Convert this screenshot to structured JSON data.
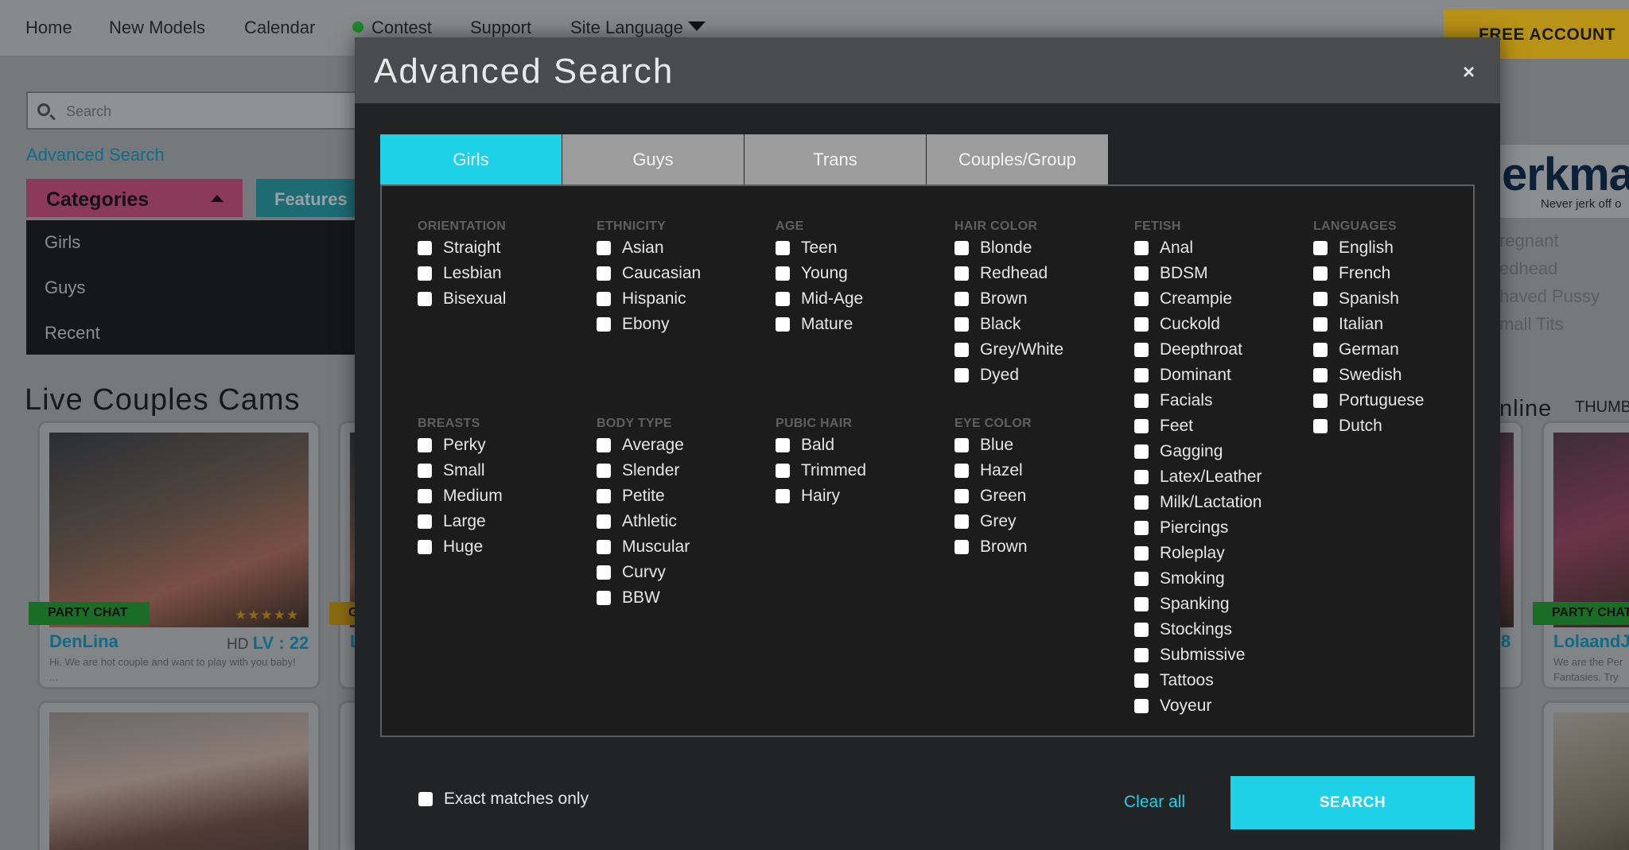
{
  "nav": {
    "home": "Home",
    "new_models": "New Models",
    "calendar": "Calendar",
    "contest": "Contest",
    "support": "Support",
    "site_language": "Site Language",
    "free_account": "FREE ACCOUNT"
  },
  "search": {
    "placeholder": "Search"
  },
  "advanced_search_link": "Advanced Search",
  "sidebar": {
    "categories_label": "Categories",
    "features_label": "Features",
    "items": [
      "Girls",
      "Guys",
      "Recent"
    ]
  },
  "live_title": "Live Couples Cams",
  "cards": [
    {
      "badge": "PARTY CHAT",
      "stars": "★★★★★",
      "name": "DenLina",
      "hd": "HD",
      "lv": "LV : 22",
      "desc": "Hi. We are hot couple and want to play with you baby! ..."
    },
    {
      "badge": "PARTY CHAT",
      "name": "LolaandJ",
      "desc": "We are the Per Fantasies. Try"
    }
  ],
  "partial_text": {
    "right_list": [
      "regnant",
      "edhead",
      "haved Pussy",
      "mall Tits"
    ],
    "online": "nline",
    "thumb": "THUMB",
    "erk_big": "erkma",
    "erk_small": "Never jerk off o",
    "num_8": "8",
    "mid_card_letter": "G",
    "mid_card_name": "L"
  },
  "modal": {
    "title": "Advanced Search",
    "close": "×",
    "tabs": [
      "Girls",
      "Guys",
      "Trans",
      "Couples/Group"
    ],
    "active_tab": "Girls",
    "groups": {
      "orientation": {
        "title": "ORIENTATION",
        "options": [
          "Straight",
          "Lesbian",
          "Bisexual"
        ]
      },
      "ethnicity": {
        "title": "ETHNICITY",
        "options": [
          "Asian",
          "Caucasian",
          "Hispanic",
          "Ebony"
        ]
      },
      "age": {
        "title": "AGE",
        "options": [
          "Teen",
          "Young",
          "Mid-Age",
          "Mature"
        ]
      },
      "hair_color": {
        "title": "HAIR COLOR",
        "options": [
          "Blonde",
          "Redhead",
          "Brown",
          "Black",
          "Grey/White",
          "Dyed"
        ]
      },
      "fetish": {
        "title": "FETISH",
        "options": [
          "Anal",
          "BDSM",
          "Creampie",
          "Cuckold",
          "Deepthroat",
          "Dominant",
          "Facials",
          "Feet",
          "Gagging",
          "Latex/Leather",
          "Milk/Lactation",
          "Piercings",
          "Roleplay",
          "Smoking",
          "Spanking",
          "Stockings",
          "Submissive",
          "Tattoos",
          "Voyeur"
        ]
      },
      "languages": {
        "title": "LANGUAGES",
        "options": [
          "English",
          "French",
          "Spanish",
          "Italian",
          "German",
          "Swedish",
          "Portuguese",
          "Dutch"
        ]
      },
      "breasts": {
        "title": "BREASTS",
        "options": [
          "Perky",
          "Small",
          "Medium",
          "Large",
          "Huge"
        ]
      },
      "body_type": {
        "title": "BODY TYPE",
        "options": [
          "Average",
          "Slender",
          "Petite",
          "Athletic",
          "Muscular",
          "Curvy",
          "BBW"
        ]
      },
      "pubic_hair": {
        "title": "PUBIC HAIR",
        "options": [
          "Bald",
          "Trimmed",
          "Hairy"
        ]
      },
      "eye_color": {
        "title": "EYE COLOR",
        "options": [
          "Blue",
          "Hazel",
          "Green",
          "Grey",
          "Brown"
        ]
      }
    },
    "exact_matches": "Exact matches only",
    "clear_all": "Clear all",
    "search_button": "SEARCH"
  },
  "colors": {
    "accent": "#1ed1e6",
    "modal_bg": "#222324",
    "modal_header": "#4a4b4c",
    "tab_inactive": "#9c9c9c"
  }
}
